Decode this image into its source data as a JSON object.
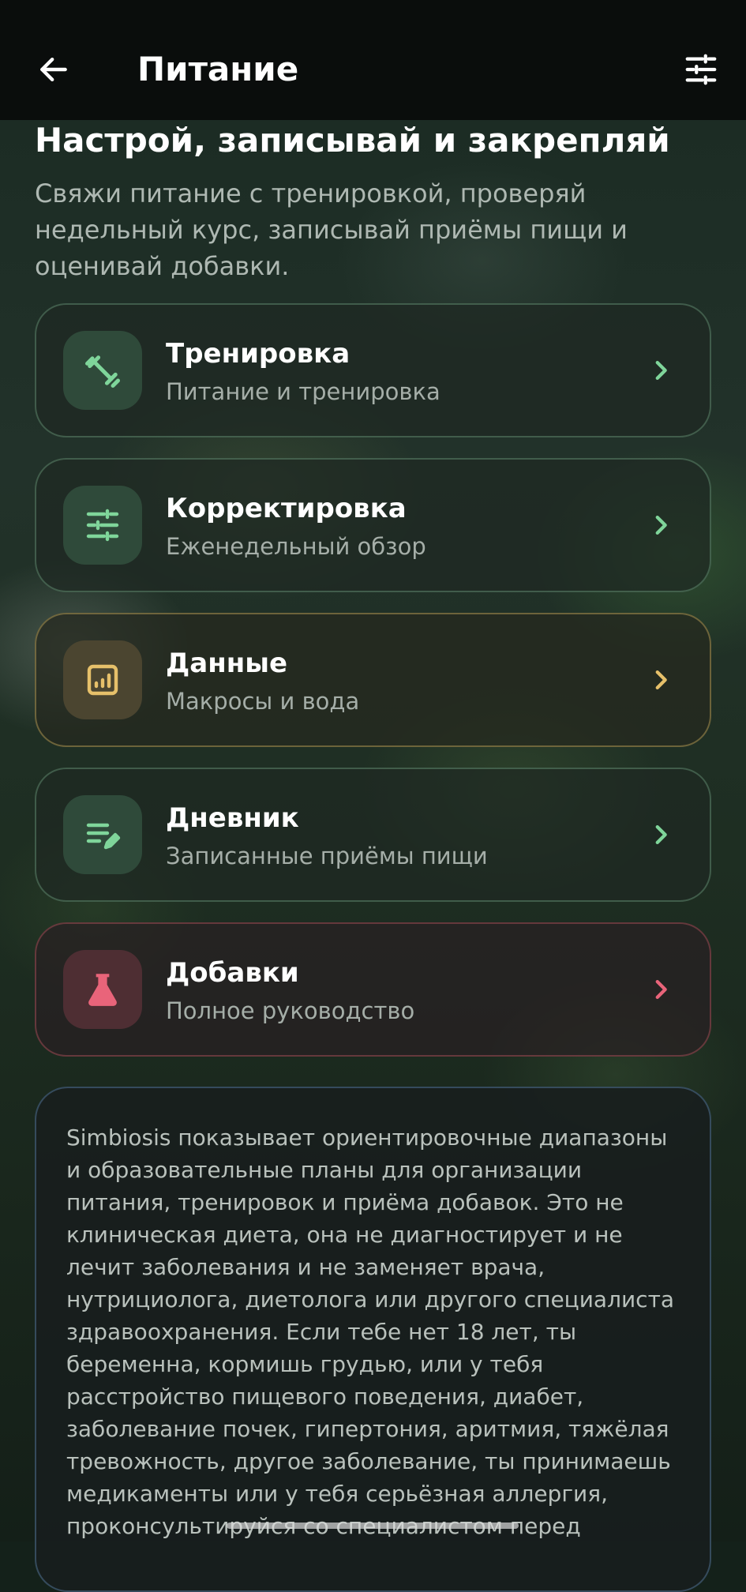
{
  "header": {
    "title": "Питание",
    "back_icon": "arrow-left-icon",
    "filter_icon": "sliders-icon"
  },
  "intro": {
    "heading": "Настрой, записывай и закрепляй",
    "subheading": "Свяжи питание с тренировкой, проверяй недельный курс, записывай приёмы пищи и оценивай добавки."
  },
  "menu": {
    "items": [
      {
        "title": "Тренировка",
        "subtitle": "Питание и тренировка",
        "icon": "dumbbell-icon",
        "accent": "#7fd59a"
      },
      {
        "title": "Корректировка",
        "subtitle": "Еженедельный обзор",
        "icon": "sliders-icon",
        "accent": "#7fd59a"
      },
      {
        "title": "Данные",
        "subtitle": "Макросы и вода",
        "icon": "chart-box-icon",
        "accent": "#e6c06a"
      },
      {
        "title": "Дневник",
        "subtitle": "Записанные приёмы пищи",
        "icon": "notes-edit-icon",
        "accent": "#7fd59a"
      },
      {
        "title": "Добавки",
        "subtitle": "Полное руководство",
        "icon": "flask-icon",
        "accent": "#e9647a"
      }
    ]
  },
  "disclaimer": {
    "text": "Simbiosis показывает ориентировочные диапазоны и образовательные планы для организации питания, тренировок и приёма добавок. Это не клиническая диета, она не диагностирует и не лечит заболевания и не заменяет врача, нутрициолога, диетолога или другого специалиста здравоохранения. Если тебе нет 18 лет, ты беременна, кормишь грудью, или у тебя расстройство пищевого поведения, диабет, заболевание почек, гипертония, аритмия, тяжёлая тревожность, другое заболевание, ты принимаешь медикаменты или у тебя серьёзная аллергия, проконсультируйся со специалистом перед"
  },
  "colors": {
    "green": "#7fd59a",
    "gold": "#e6c06a",
    "red": "#e9647a",
    "topbar": "#0a0d0c"
  }
}
